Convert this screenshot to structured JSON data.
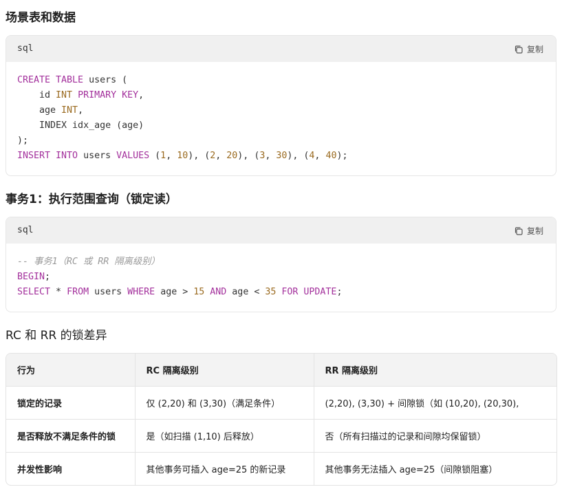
{
  "heading1": "场景表和数据",
  "code1": {
    "lang": "sql",
    "copy": "复制",
    "lines": [
      [
        {
          "t": "CREATE TABLE",
          "c": "kw"
        },
        {
          "t": " users (",
          "c": ""
        }
      ],
      [
        {
          "t": "    id ",
          "c": ""
        },
        {
          "t": "INT",
          "c": "num"
        },
        {
          "t": " ",
          "c": ""
        },
        {
          "t": "PRIMARY KEY",
          "c": "kw"
        },
        {
          "t": ",",
          "c": ""
        }
      ],
      [
        {
          "t": "    age ",
          "c": ""
        },
        {
          "t": "INT",
          "c": "num"
        },
        {
          "t": ",",
          "c": ""
        }
      ],
      [
        {
          "t": "    INDEX idx_age (age)",
          "c": ""
        }
      ],
      [
        {
          "t": ");",
          "c": ""
        }
      ],
      [
        {
          "t": "INSERT INTO",
          "c": "kw"
        },
        {
          "t": " users ",
          "c": ""
        },
        {
          "t": "VALUES",
          "c": "kw"
        },
        {
          "t": " (",
          "c": ""
        },
        {
          "t": "1",
          "c": "num"
        },
        {
          "t": ", ",
          "c": ""
        },
        {
          "t": "10",
          "c": "num"
        },
        {
          "t": "), (",
          "c": ""
        },
        {
          "t": "2",
          "c": "num"
        },
        {
          "t": ", ",
          "c": ""
        },
        {
          "t": "20",
          "c": "num"
        },
        {
          "t": "), (",
          "c": ""
        },
        {
          "t": "3",
          "c": "num"
        },
        {
          "t": ", ",
          "c": ""
        },
        {
          "t": "30",
          "c": "num"
        },
        {
          "t": "), (",
          "c": ""
        },
        {
          "t": "4",
          "c": "num"
        },
        {
          "t": ", ",
          "c": ""
        },
        {
          "t": "40",
          "c": "num"
        },
        {
          "t": ");",
          "c": ""
        }
      ]
    ]
  },
  "heading2": "事务1：执行范围查询（锁定读）",
  "code2": {
    "lang": "sql",
    "copy": "复制",
    "lines": [
      [
        {
          "t": "-- 事务1（RC 或 RR 隔离级别）",
          "c": "cm"
        }
      ],
      [
        {
          "t": "BEGIN",
          "c": "kw"
        },
        {
          "t": ";",
          "c": ""
        }
      ],
      [
        {
          "t": "SELECT",
          "c": "kw"
        },
        {
          "t": " * ",
          "c": ""
        },
        {
          "t": "FROM",
          "c": "kw"
        },
        {
          "t": " users ",
          "c": ""
        },
        {
          "t": "WHERE",
          "c": "kw"
        },
        {
          "t": " age > ",
          "c": ""
        },
        {
          "t": "15",
          "c": "num"
        },
        {
          "t": " ",
          "c": ""
        },
        {
          "t": "AND",
          "c": "kw"
        },
        {
          "t": " age < ",
          "c": ""
        },
        {
          "t": "35",
          "c": "num"
        },
        {
          "t": " ",
          "c": ""
        },
        {
          "t": "FOR UPDATE",
          "c": "kw"
        },
        {
          "t": ";",
          "c": ""
        }
      ]
    ]
  },
  "heading3": "RC 和 RR 的锁差异",
  "table": {
    "headers": [
      "行为",
      "RC 隔离级别",
      "RR 隔离级别"
    ],
    "rows": [
      [
        "锁定的记录",
        "仅 (2,20) 和 (3,30)（满足条件）",
        "(2,20), (3,30) + 间隙锁（如 (10,20), (20,30), "
      ],
      [
        "是否释放不满足条件的锁",
        "是（如扫描 (1,10) 后释放）",
        "否（所有扫描过的记录和间隙均保留锁）"
      ],
      [
        "并发性影响",
        "其他事务可插入 age=25 的新记录",
        "其他事务无法插入 age=25（间隙锁阻塞）"
      ]
    ]
  }
}
